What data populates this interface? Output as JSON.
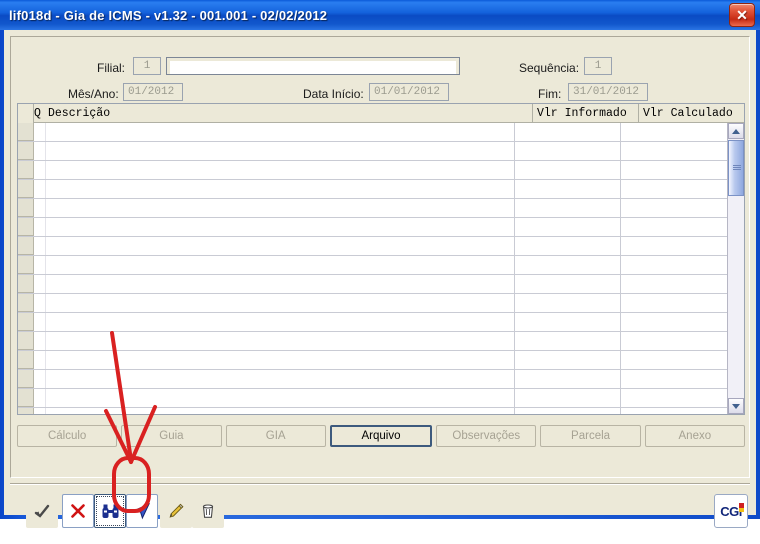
{
  "window": {
    "title": "lif018d - Gia de ICMS - v1.32 - 001.001 - 02/02/2012",
    "close_glyph": "✕",
    "accent_color": "#1462dc"
  },
  "form": {
    "filial_label": "Filial:",
    "filial_value": "1",
    "filial_name_value": "",
    "sequencia_label": "Sequência:",
    "sequencia_value": "1",
    "mesano_label": "Mês/Ano:",
    "mesano_value": "01/2012",
    "data_inicio_label": "Data Início:",
    "data_inicio_value": "01/01/2012",
    "fim_label": "Fim:",
    "fim_value": "31/01/2012"
  },
  "grid": {
    "columns": [
      "Q",
      "Descrição",
      "Vlr Informado",
      "Vlr Calculado"
    ],
    "rows": [],
    "row_count": 16,
    "scrollbar": {
      "up_arrow": "▲",
      "down_arrow": "▼"
    }
  },
  "tabs": [
    {
      "label": "Cálculo",
      "active": false,
      "enabled": false
    },
    {
      "label": "Guia",
      "active": false,
      "enabled": false
    },
    {
      "label": "GIA",
      "active": false,
      "enabled": false
    },
    {
      "label": "Arquivo",
      "active": true,
      "enabled": true
    },
    {
      "label": "Observações",
      "active": false,
      "enabled": false
    },
    {
      "label": "Parcela",
      "active": false,
      "enabled": false
    },
    {
      "label": "Anexo",
      "active": false,
      "enabled": false
    }
  ],
  "toolbar": {
    "buttons": [
      {
        "name": "confirm-button",
        "icon": "checkmark-icon"
      },
      {
        "name": "cancel-button",
        "icon": "close-x-icon"
      },
      {
        "name": "search-button",
        "icon": "binoculars-icon"
      },
      {
        "name": "send-button",
        "icon": "send-arrow-icon"
      },
      {
        "name": "edit-button",
        "icon": "pencil-icon"
      },
      {
        "name": "delete-button",
        "icon": "trash-icon"
      }
    ],
    "logo_label": "CGi"
  },
  "annotation": {
    "color": "#d92121",
    "highlight_target": "send-button",
    "shapes": [
      "arrow",
      "oval"
    ]
  }
}
